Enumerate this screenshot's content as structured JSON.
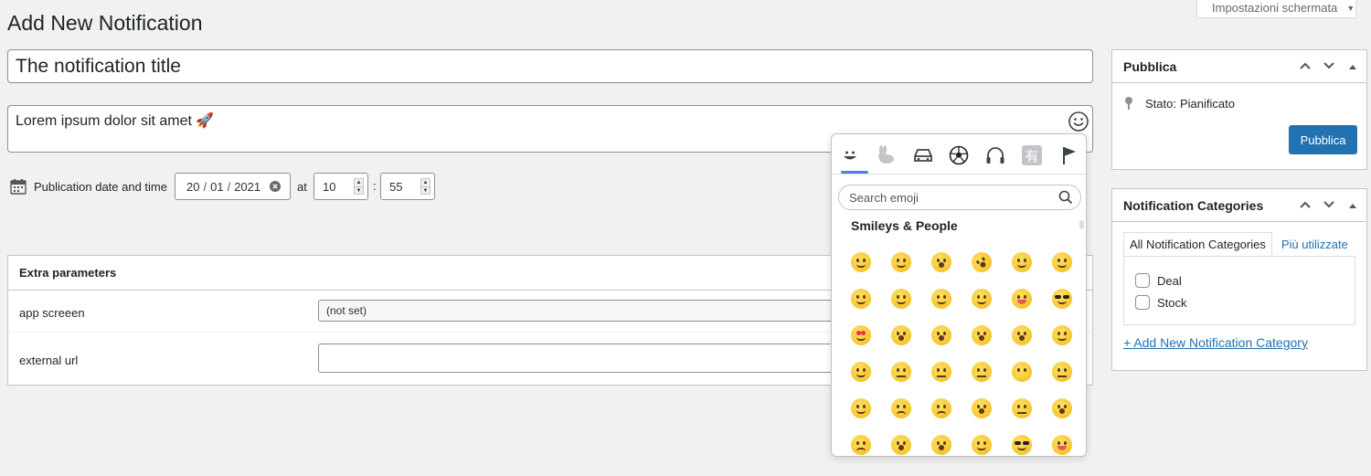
{
  "screen_options": {
    "label": "Impostazioni schermata",
    "arrow": "▼"
  },
  "page": {
    "title": "Add New Notification"
  },
  "form": {
    "title_value": "The notification title",
    "message_value": "Lorem ipsum dolor sit amet",
    "message_emoji": "🚀",
    "pubdate_label": "Publication date and time",
    "date": {
      "day": "20",
      "month": "01",
      "year": "2021",
      "sep": "/"
    },
    "at_label": "at",
    "hour": "10",
    "colon": ":",
    "minute": "55"
  },
  "extra": {
    "heading": "Extra parameters",
    "rows": [
      {
        "label": "app screeen",
        "value": "(not set)"
      },
      {
        "label": "external url",
        "value": ""
      }
    ]
  },
  "emoji_picker": {
    "search_placeholder": "Search emoji",
    "section_title": "Smileys & People",
    "tabs": [
      "smileys",
      "animals",
      "travel",
      "activities",
      "objects",
      "symbols",
      "flags"
    ],
    "symbols_tab_glyph": "有",
    "active_color": "#4f81e5"
  },
  "sidebar": {
    "publish": {
      "title": "Pubblica",
      "status_label": "Stato:",
      "status_value": "Pianificato",
      "button": "Pubblica"
    },
    "categories": {
      "title": "Notification Categories",
      "tab_all": "All Notification Categories",
      "tab_used": "Più utilizzate",
      "items": [
        "Deal",
        "Stock"
      ],
      "add_link": "+ Add New Notification Category"
    },
    "controls": {
      "up": "⌃",
      "down": "⌄",
      "toggle": "▲"
    }
  },
  "colors": {
    "primary": "#2271b1",
    "background": "#f1f1f1"
  }
}
